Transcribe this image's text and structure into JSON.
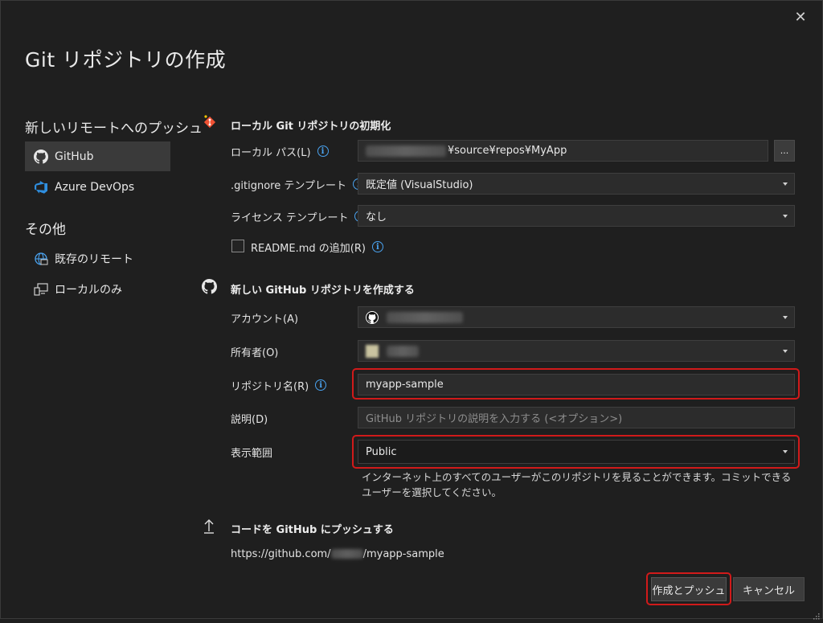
{
  "window": {
    "title": "Git リポジトリの作成",
    "close_label": "✕"
  },
  "sidebar": {
    "push_heading": "新しいリモートへのプッシュ",
    "push_items": [
      {
        "label": "GitHub",
        "icon": "github-icon",
        "selected": true
      },
      {
        "label": "Azure DevOps",
        "icon": "azure-devops-icon",
        "selected": false
      }
    ],
    "other_heading": "その他",
    "other_items": [
      {
        "label": "既存のリモート",
        "icon": "globe-remote-icon"
      },
      {
        "label": "ローカルのみ",
        "icon": "local-computer-icon"
      }
    ]
  },
  "local_section": {
    "heading": "ローカル Git リポジトリの初期化",
    "icon": "git-logo-icon",
    "local_path_label": "ローカル パス(L)",
    "local_path_value": "¥source¥repos¥MyApp",
    "browse_label": "...",
    "gitignore_label": ".gitignore テンプレート",
    "gitignore_value": "既定値 (VisualStudio)",
    "license_label": "ライセンス テンプレート",
    "license_value": "なし",
    "readme_label": "README.md の追加(R)",
    "readme_checked": false
  },
  "github_section": {
    "heading": "新しい GitHub リポジトリを作成する",
    "icon": "github-icon",
    "account_label": "アカウント(A)",
    "owner_label": "所有者(O)",
    "repo_name_label": "リポジトリ名(R)",
    "repo_name_value": "myapp-sample",
    "description_label": "説明(D)",
    "description_placeholder": "GitHub リポジトリの説明を入力する (<オプション>)",
    "visibility_label": "表示範囲",
    "visibility_value": "Public",
    "visibility_help": "インターネット上のすべてのユーザーがこのリポジトリを見ることができます。コミットできるユーザーを選択してください。"
  },
  "push_section": {
    "heading": "コードを GitHub にプッシュする",
    "icon": "upload-arrow-icon",
    "url_prefix": "https://github.com/",
    "url_suffix": "/myapp-sample"
  },
  "footer": {
    "create_push_label": "作成とプッシュ",
    "cancel_label": "キャンセル"
  },
  "colors": {
    "background": "#1f1f1f",
    "field": "#2c2c2c",
    "accent_info": "#4aa3f0",
    "highlight_red": "#d11a1a",
    "selected_item": "#3a3a3a"
  }
}
